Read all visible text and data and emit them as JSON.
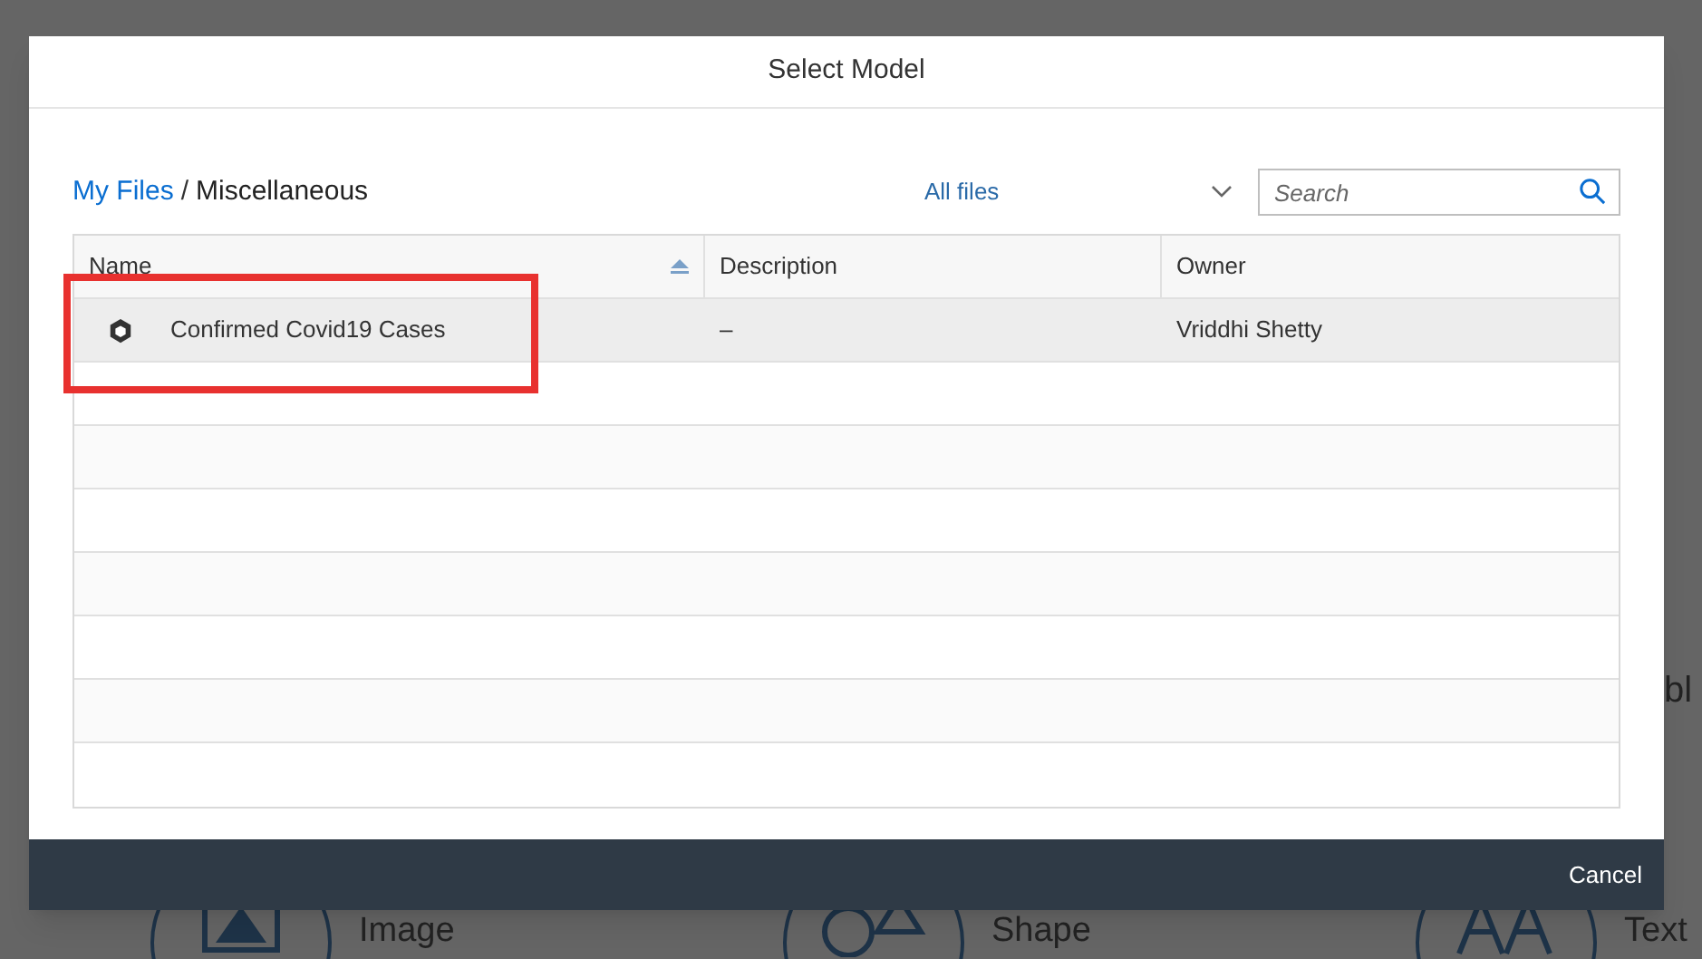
{
  "background": {
    "side_text": "bl",
    "tiles": [
      {
        "kind": "image",
        "label": "Image"
      },
      {
        "kind": "shape",
        "label": "Shape"
      },
      {
        "kind": "text",
        "label": "Text"
      }
    ]
  },
  "dialog": {
    "title": "Select Model",
    "breadcrumb": {
      "link": "My Files",
      "separator": "/",
      "current": "Miscellaneous"
    },
    "filter": {
      "value": "All files"
    },
    "search": {
      "placeholder": "Search"
    },
    "table": {
      "columns": [
        {
          "label": "Name",
          "sorted": true
        },
        {
          "label": "Description",
          "sorted": false
        },
        {
          "label": "Owner",
          "sorted": false
        }
      ],
      "rows": [
        {
          "name": "Confirmed Covid19 Cases",
          "description": "–",
          "owner": "Vriddhi Shetty",
          "selected": true,
          "highlighted": true
        }
      ]
    },
    "buttons": [
      "Cancel"
    ]
  }
}
